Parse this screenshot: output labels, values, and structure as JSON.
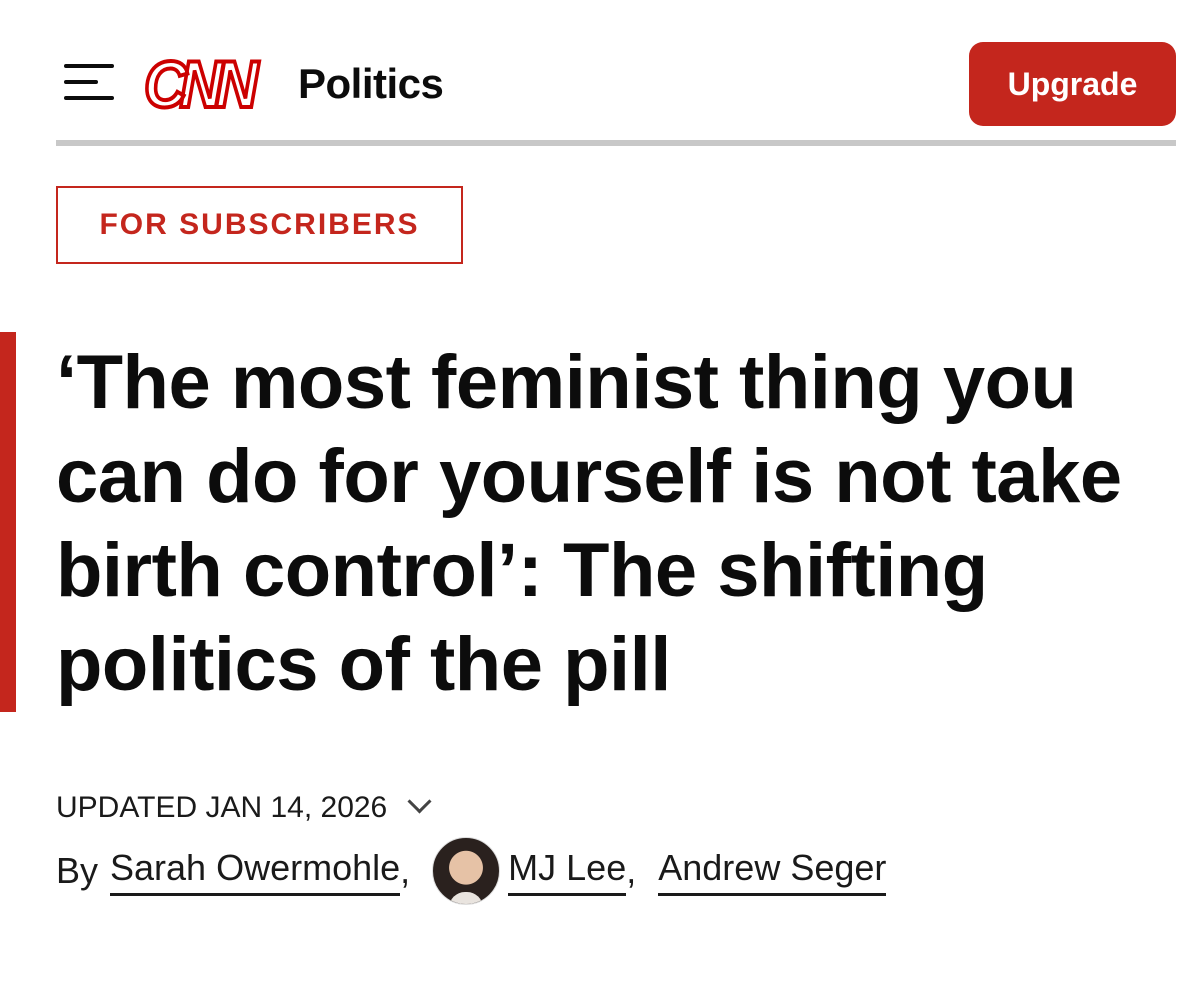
{
  "header": {
    "menu_icon": "hamburger-menu-icon",
    "logo_text": "CNN",
    "section": "Politics",
    "upgrade_label": "Upgrade",
    "accent_color": "#c4261d"
  },
  "badge": {
    "label": "FOR SUBSCRIBERS"
  },
  "article": {
    "headline": "‘The most feminist thing you can do for yourself is not take birth control’: The shifting politics of the pill",
    "updated": "UPDATED JAN 14, 2026",
    "byline_prefix": "By",
    "authors": [
      {
        "name": "Sarah Owermohle"
      },
      {
        "name": "MJ Lee"
      },
      {
        "name": "Andrew Seger"
      }
    ],
    "separator": ","
  }
}
